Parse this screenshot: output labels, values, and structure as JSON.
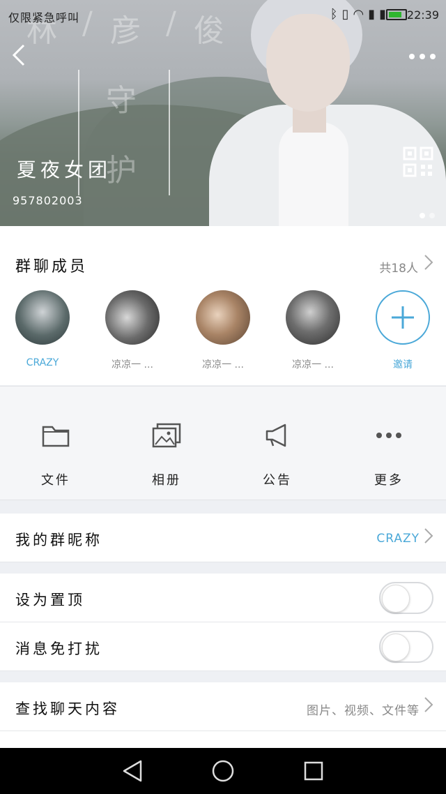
{
  "status": {
    "carrier": "仅限紧急呼叫",
    "time": "22:39",
    "icons": [
      "bluetooth-icon",
      "vibrate-icon",
      "wifi-icon",
      "sim1-icon",
      "sim2-icon",
      "battery-icon"
    ]
  },
  "header": {
    "bg_chars": [
      "林",
      "/",
      "彦",
      "/",
      "俊",
      "守",
      "护"
    ],
    "group_name": "夏夜女团",
    "group_id": "957802003"
  },
  "members": {
    "title": "群聊成员",
    "count": "共18人",
    "list": [
      {
        "name": "CRAZY",
        "highlight": true
      },
      {
        "name": "凉凉一 ..."
      },
      {
        "name": "凉凉一 ..."
      },
      {
        "name": "凉凉一 ..."
      }
    ],
    "invite_label": "邀请"
  },
  "tools": [
    {
      "label": "文件",
      "icon": "folder-icon"
    },
    {
      "label": "相册",
      "icon": "album-icon"
    },
    {
      "label": "公告",
      "icon": "announcement-icon"
    },
    {
      "label": "更多",
      "icon": "more-dots-icon"
    }
  ],
  "settings": {
    "nickname_label": "我的群昵称",
    "nickname_value": "CRAZY",
    "pin_label": "设为置顶",
    "mute_label": "消息免打扰",
    "search_label": "查找聊天内容",
    "search_hint": "图片、视频、文件等"
  },
  "colors": {
    "accent": "#4aa8d8"
  }
}
